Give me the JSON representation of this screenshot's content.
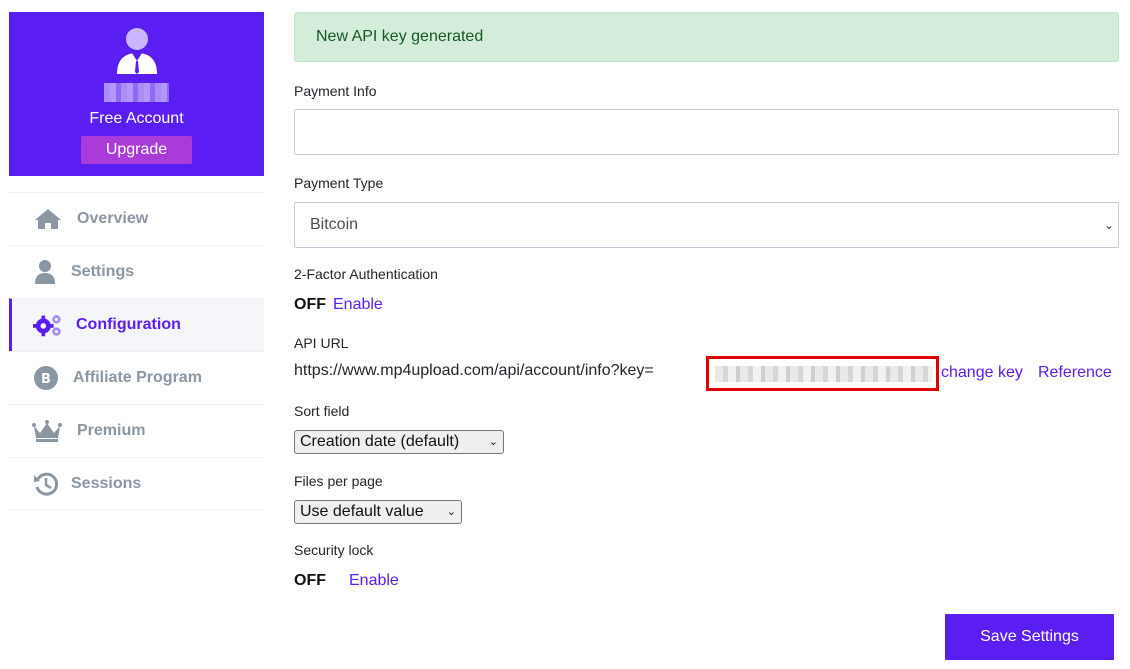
{
  "sidebar": {
    "account_type": "Free Account",
    "upgrade_label": "Upgrade",
    "items": [
      {
        "label": "Overview",
        "icon": "home-icon"
      },
      {
        "label": "Settings",
        "icon": "user-icon"
      },
      {
        "label": "Configuration",
        "icon": "gears-icon",
        "active": true
      },
      {
        "label": "Affiliate Program",
        "icon": "bitcoin-icon"
      },
      {
        "label": "Premium",
        "icon": "crown-icon"
      },
      {
        "label": "Sessions",
        "icon": "history-icon"
      }
    ]
  },
  "alert": {
    "message": "New API key generated"
  },
  "form": {
    "payment_info": {
      "label": "Payment Info",
      "value": ""
    },
    "payment_type": {
      "label": "Payment Type",
      "selected": "Bitcoin"
    },
    "two_factor": {
      "label": "2-Factor Authentication",
      "status": "OFF",
      "action": "Enable"
    },
    "api_url": {
      "label": "API URL",
      "url_prefix": "https://www.mp4upload.com/api/account/info?key=",
      "change_key": "change key",
      "reference": "Reference"
    },
    "sort_field": {
      "label": "Sort field",
      "selected": "Creation date (default)"
    },
    "files_per_page": {
      "label": "Files per page",
      "selected": "Use default value"
    },
    "security_lock": {
      "label": "Security lock",
      "status": "OFF",
      "action": "Enable"
    },
    "save_label": "Save Settings"
  },
  "colors": {
    "accent": "#5a1df2",
    "upgrade": "#a93bd9",
    "success_bg": "#d4edda",
    "highlight_border": "#e00000"
  }
}
